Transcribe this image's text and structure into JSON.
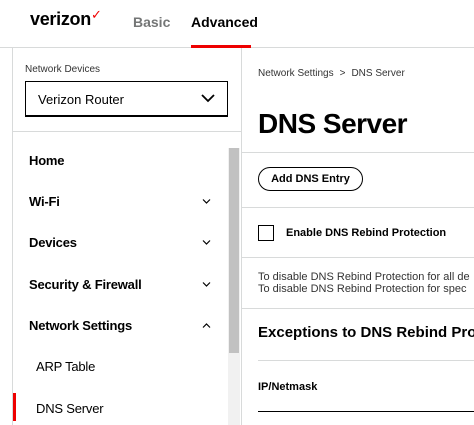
{
  "header": {
    "logo_text": "verizon",
    "logo_check": "✓",
    "tabs": [
      {
        "label": "Basic",
        "active": false
      },
      {
        "label": "Advanced",
        "active": true
      }
    ]
  },
  "sidebar": {
    "device_label": "Network Devices",
    "device_selected": "Verizon Router",
    "items": [
      {
        "label": "Home",
        "expandable": false
      },
      {
        "label": "Wi-Fi",
        "expandable": true,
        "expanded": false
      },
      {
        "label": "Devices",
        "expandable": true,
        "expanded": false
      },
      {
        "label": "Security & Firewall",
        "expandable": true,
        "expanded": false
      },
      {
        "label": "Network Settings",
        "expandable": true,
        "expanded": true
      },
      {
        "label": "ARP Table",
        "sub": true
      },
      {
        "label": "DNS Server",
        "sub": true,
        "active": true
      }
    ]
  },
  "breadcrumb": {
    "parent": "Network Settings",
    "separator": ">",
    "current": "DNS Server"
  },
  "main": {
    "title": "DNS Server",
    "add_button": "Add DNS Entry",
    "rebind_checkbox_label": "Enable DNS Rebind Protection",
    "rebind_checked": false,
    "info_line_1": "To disable DNS Rebind Protection for all de",
    "info_line_2": "To disable DNS Rebind Protection for spec",
    "exceptions_title": "Exceptions to DNS Rebind Prot",
    "ip_netmask_label": "IP/Netmask"
  },
  "colors": {
    "accent": "#ee0000",
    "border": "#d8dada",
    "text": "#000000",
    "muted_tab": "#747676"
  }
}
